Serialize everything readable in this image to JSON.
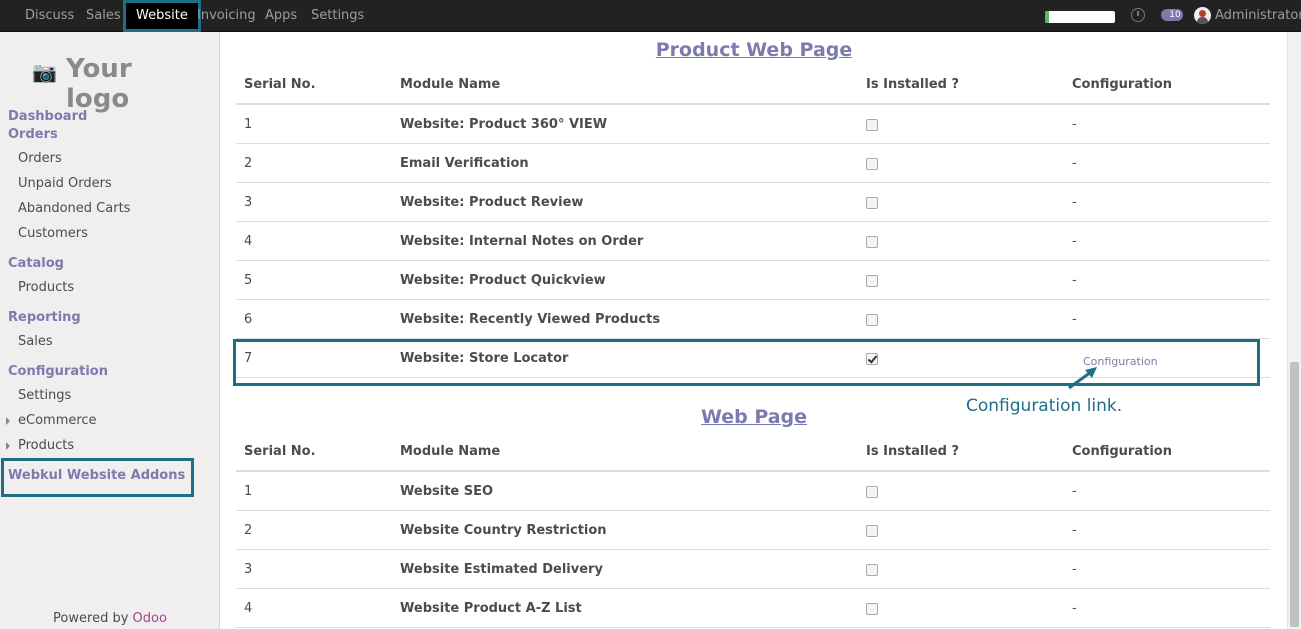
{
  "topbar": {
    "menu": [
      "Discuss",
      "Sales",
      "Website",
      "Invoicing",
      "Apps",
      "Settings"
    ],
    "active_menu": "Website",
    "progress_fraction": 0.05,
    "chat_count": "10",
    "user": "Administrator",
    "icons": [
      "clock-icon",
      "chat-icon",
      "avatar"
    ]
  },
  "sidebar": {
    "logo_text": "Your logo",
    "dashboard": "Dashboard",
    "orders_head": "Orders",
    "orders_items": [
      "Orders",
      "Unpaid Orders",
      "Abandoned Carts",
      "Customers"
    ],
    "catalog_head": "Catalog",
    "catalog_items": [
      "Products"
    ],
    "reporting_head": "Reporting",
    "reporting_items": [
      "Sales"
    ],
    "configuration_head": "Configuration",
    "configuration_items": [
      "Settings",
      "eCommerce",
      "Products"
    ],
    "addons": "Webkul Website Addons",
    "powered_by": "Powered by",
    "brand": "Odoo"
  },
  "product_section": {
    "title": "Product Web Page",
    "headers": [
      "Serial No.",
      "Module Name",
      "Is Installed ?",
      "Configuration"
    ],
    "rows": [
      {
        "no": "1",
        "name": "Website: Product 360° VIEW",
        "installed": false,
        "config": "-"
      },
      {
        "no": "2",
        "name": "Email Verification",
        "installed": false,
        "config": "-"
      },
      {
        "no": "3",
        "name": "Website: Product Review",
        "installed": false,
        "config": "-"
      },
      {
        "no": "4",
        "name": "Website: Internal Notes on Order",
        "installed": false,
        "config": "-"
      },
      {
        "no": "5",
        "name": "Website: Product Quickview",
        "installed": false,
        "config": "-"
      },
      {
        "no": "6",
        "name": "Website: Recently Viewed Products",
        "installed": false,
        "config": "-"
      },
      {
        "no": "7",
        "name": "Website: Store Locator",
        "installed": true,
        "config": "Configuration"
      }
    ]
  },
  "callout": "Configuration link.",
  "web_section": {
    "title": "Web Page",
    "headers": [
      "Serial No.",
      "Module Name",
      "Is Installed ?",
      "Configuration"
    ],
    "rows": [
      {
        "no": "1",
        "name": "Website SEO",
        "installed": false,
        "config": "-"
      },
      {
        "no": "2",
        "name": "Website Country Restriction",
        "installed": false,
        "config": "-"
      },
      {
        "no": "3",
        "name": "Website Estimated Delivery",
        "installed": false,
        "config": "-"
      },
      {
        "no": "4",
        "name": "Website Product A-Z List",
        "installed": false,
        "config": "-"
      }
    ]
  }
}
